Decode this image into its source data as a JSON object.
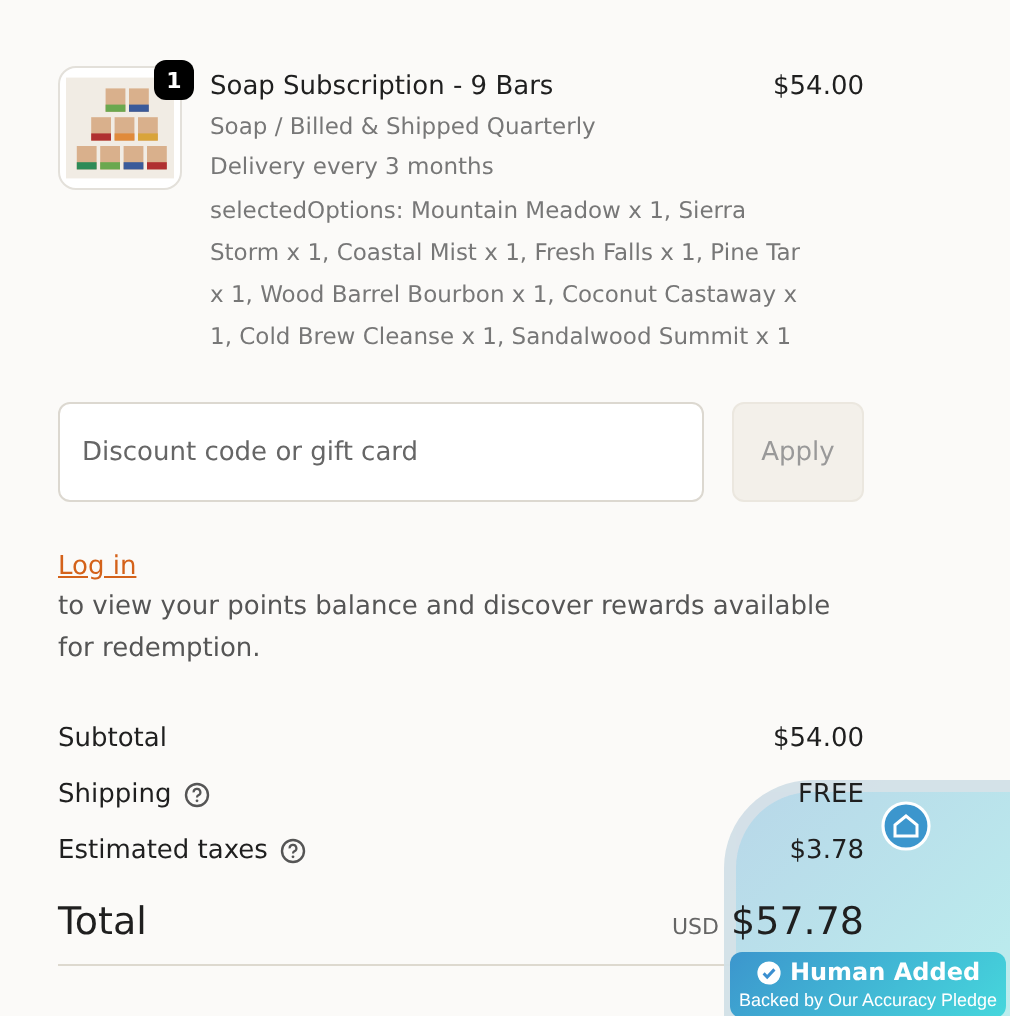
{
  "item": {
    "quantity": "1",
    "title": "Soap Subscription - 9 Bars",
    "price": "$54.00",
    "lines": [
      "Soap / Billed & Shipped Quarterly",
      "Delivery every 3 months"
    ],
    "options": "selectedOptions: Mountain Meadow x 1, Sierra Storm x 1, Coastal Mist x 1, Fresh Falls x 1, Pine Tar x 1, Wood Barrel Bourbon x 1, Coconut Castaway x 1, Cold Brew Cleanse x 1, Sandalwood Summit x 1"
  },
  "discount": {
    "placeholder": "Discount code or gift card",
    "button": "Apply"
  },
  "login": {
    "link": "Log in",
    "text": "to view your points balance and discover rewards available for redemption."
  },
  "summary": [
    {
      "label": "Subtotal",
      "value": "$54.00",
      "help": false
    },
    {
      "label": "Shipping",
      "value": "FREE",
      "help": true
    },
    {
      "label": "Estimated taxes",
      "value": "$3.78",
      "help": true
    }
  ],
  "total": {
    "label": "Total",
    "currency": "USD",
    "value": "$57.78"
  },
  "widget": {
    "title": "Human Added",
    "subtitle": "Backed by Our Accuracy Pledge"
  }
}
